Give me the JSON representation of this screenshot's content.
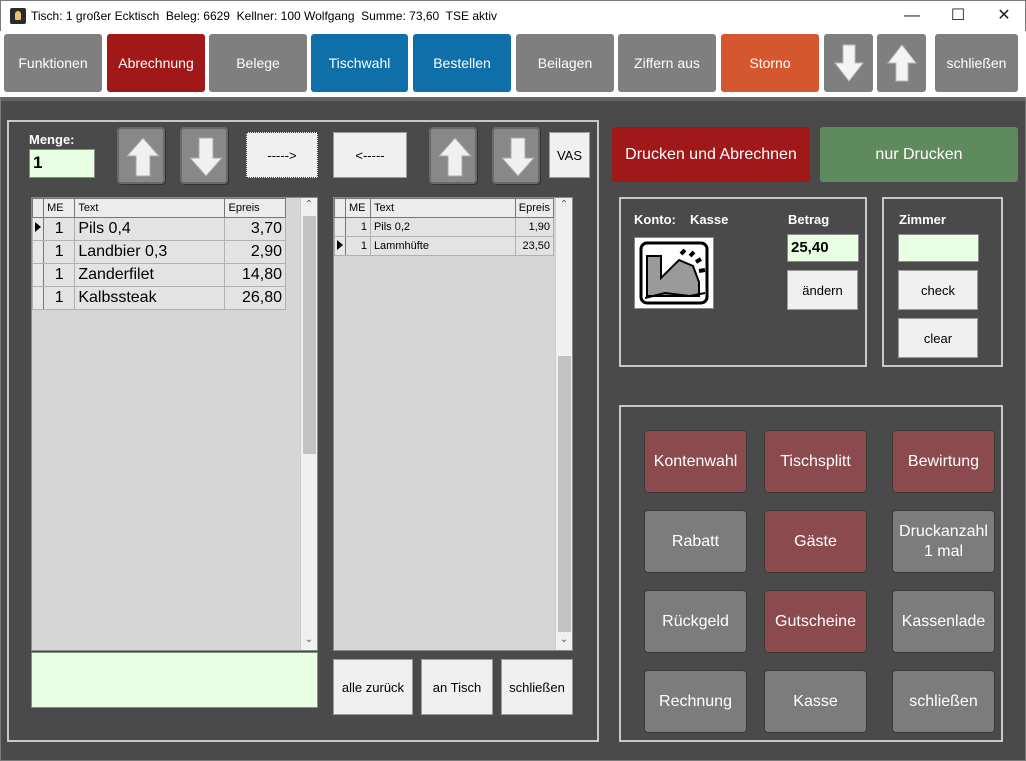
{
  "window": {
    "title": "Tisch: 1 großer Ecktisch  Beleg: 6629  Kellner: 100 Wolfgang  Summe: 73,60  TSE aktiv",
    "minimize": "—",
    "maximize": "☐",
    "close": "✕"
  },
  "toolbar": {
    "funktionen": "Funktionen",
    "abrechnung": "Abrechnung",
    "belege": "Belege",
    "tischwahl": "Tischwahl",
    "bestellen": "Bestellen",
    "beilagen": "Beilagen",
    "ziffern_aus": "Ziffern aus",
    "storno": "Storno",
    "schliessen": "schließen"
  },
  "split": {
    "menge_label": "Menge:",
    "menge_value": "1",
    "move_right": "----->",
    "move_left": "<-----",
    "vas": "VAS",
    "alle_zurueck": "alle zurück",
    "an_tisch": "an Tisch",
    "schliessen": "schließen"
  },
  "left_table": {
    "headers": [
      "ME",
      "Text",
      "Epreis"
    ],
    "rows": [
      {
        "me": "1",
        "text": "Pils 0,4",
        "price": "3,70"
      },
      {
        "me": "1",
        "text": "Landbier 0,3",
        "price": "2,90"
      },
      {
        "me": "1",
        "text": "Zanderfilet",
        "price": "14,80"
      },
      {
        "me": "1",
        "text": "Kalbssteak",
        "price": "26,80"
      }
    ]
  },
  "right_table": {
    "headers": [
      "ME",
      "Text",
      "Epreis"
    ],
    "rows": [
      {
        "me": "1",
        "text": "Pils 0,2",
        "price": "1,90"
      },
      {
        "me": "1",
        "text": "Lammhüfte",
        "price": "23,50"
      }
    ]
  },
  "payment": {
    "drucken_abrechnen": "Drucken und Abrechnen",
    "nur_drucken": "nur Drucken",
    "konto_label": "Konto:",
    "konto_value": "Kasse",
    "betrag_label": "Betrag",
    "betrag_value": "25,40",
    "aendern": "ändern",
    "zimmer_label": "Zimmer",
    "zimmer_value": "",
    "check": "check",
    "clear": "clear"
  },
  "functions": {
    "kontenwahl": "Kontenwahl",
    "tischsplitt": "Tischsplitt",
    "bewirtung": "Bewirtung",
    "rabatt": "Rabatt",
    "gaeste": "Gäste",
    "druckanzahl_1": "Druckanzahl",
    "druckanzahl_2": "1 mal",
    "rueckgeld": "Rückgeld",
    "gutscheine": "Gutscheine",
    "kassenlade": "Kassenlade",
    "rechnung": "Rechnung",
    "kasse": "Kasse",
    "schliessen": "schließen"
  },
  "colors": {
    "red": "#a01818",
    "blue": "#0f6fa8",
    "orange": "#d4572f",
    "green_btn": "#5e8a5e",
    "rose": "#8b4a4d",
    "panel_bg": "#4a4a4a"
  }
}
